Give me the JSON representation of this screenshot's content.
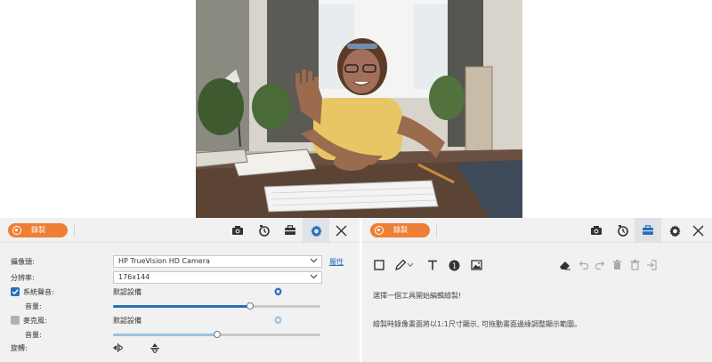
{
  "left_panel": {
    "record_label": "錄製",
    "tabs": [
      "camera",
      "timer",
      "toolbox",
      "settings",
      "close"
    ],
    "rows": {
      "camera_label": "攝像頭:",
      "camera_value": "HP TrueVision HD Camera",
      "camera_link": "屬性",
      "resolution_label": "分辨率:",
      "resolution_value": "176x144",
      "system_sound_label": "系統聲音:",
      "system_sound_checked": true,
      "system_sound_device": "默認設備",
      "volume_label_1": "音量:",
      "system_volume": 0.66,
      "microphone_label": "麥克風:",
      "microphone_checked": false,
      "microphone_device": "默認設備",
      "volume_label_2": "音量:",
      "microphone_volume": 0.5,
      "rotate_label": "旋轉:"
    },
    "colors": {
      "accent": "#f07f36",
      "slider_active": "#2471b8",
      "slider_inactive": "#9cc2e0"
    }
  },
  "right_panel": {
    "record_label": "錄製",
    "tabs": [
      "camera",
      "timer",
      "toolbox-active",
      "settings",
      "close"
    ],
    "tools": [
      "rectangle-tool",
      "pen-tool",
      "text-tool",
      "step-number-tool",
      "image-tool",
      "eraser",
      "undo",
      "redo",
      "delete",
      "clear-all",
      "exit"
    ],
    "hint_1": "選擇一個工具開始編輯繪製!",
    "hint_2": "繪製時錄像畫面將以1:1尺寸顯示, 可拖動畫面邊緣調整顯示範圍。"
  }
}
